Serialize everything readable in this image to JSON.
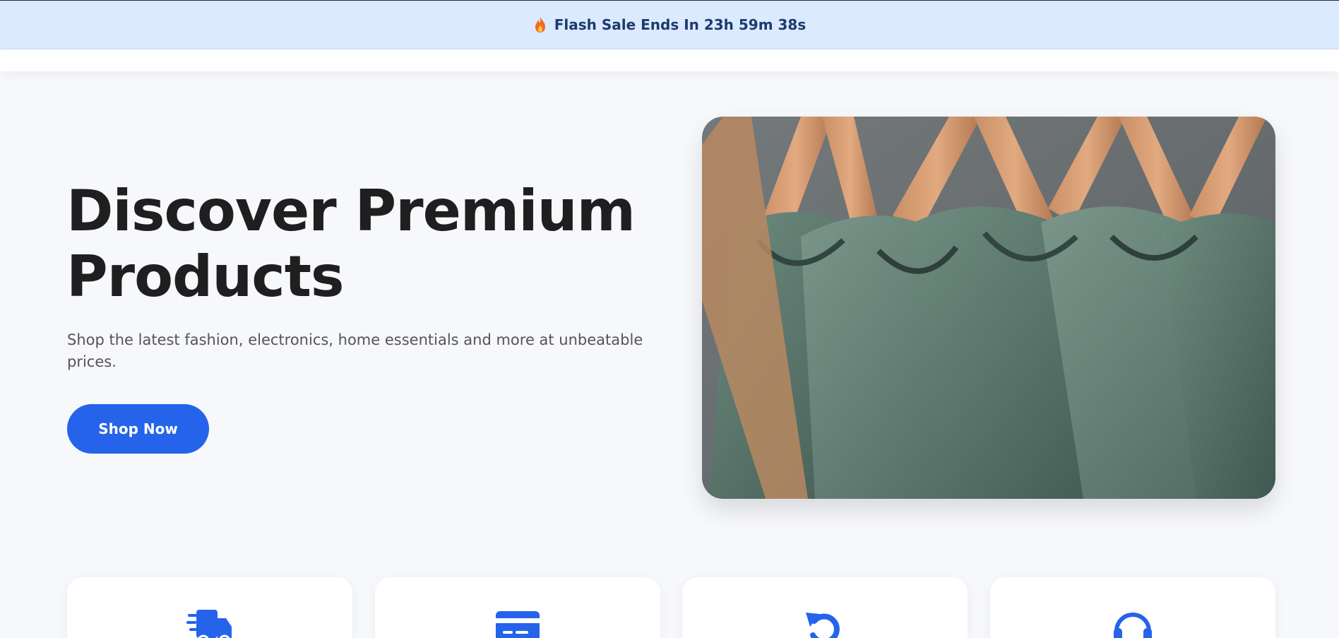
{
  "flash_sale": {
    "icon": "fire-icon",
    "text": "Flash Sale Ends In 23h 59m 38s"
  },
  "hero": {
    "title_line1": "Discover Premium",
    "title_line2": "Products",
    "subtitle": "Shop the latest fashion, electronics, home essentials and more at unbeatable prices.",
    "cta_label": "Shop Now",
    "image": "green-tshirts-on-wooden-hangers"
  },
  "features": [
    {
      "icon": "delivery-truck-icon"
    },
    {
      "icon": "credit-card-icon"
    },
    {
      "icon": "return-arrow-icon"
    },
    {
      "icon": "headset-support-icon"
    }
  ],
  "colors": {
    "accent": "#2563eb",
    "flash_bg": "#dbeafe",
    "flash_text": "#1e3a6e",
    "page_bg": "#f7f8fb"
  }
}
